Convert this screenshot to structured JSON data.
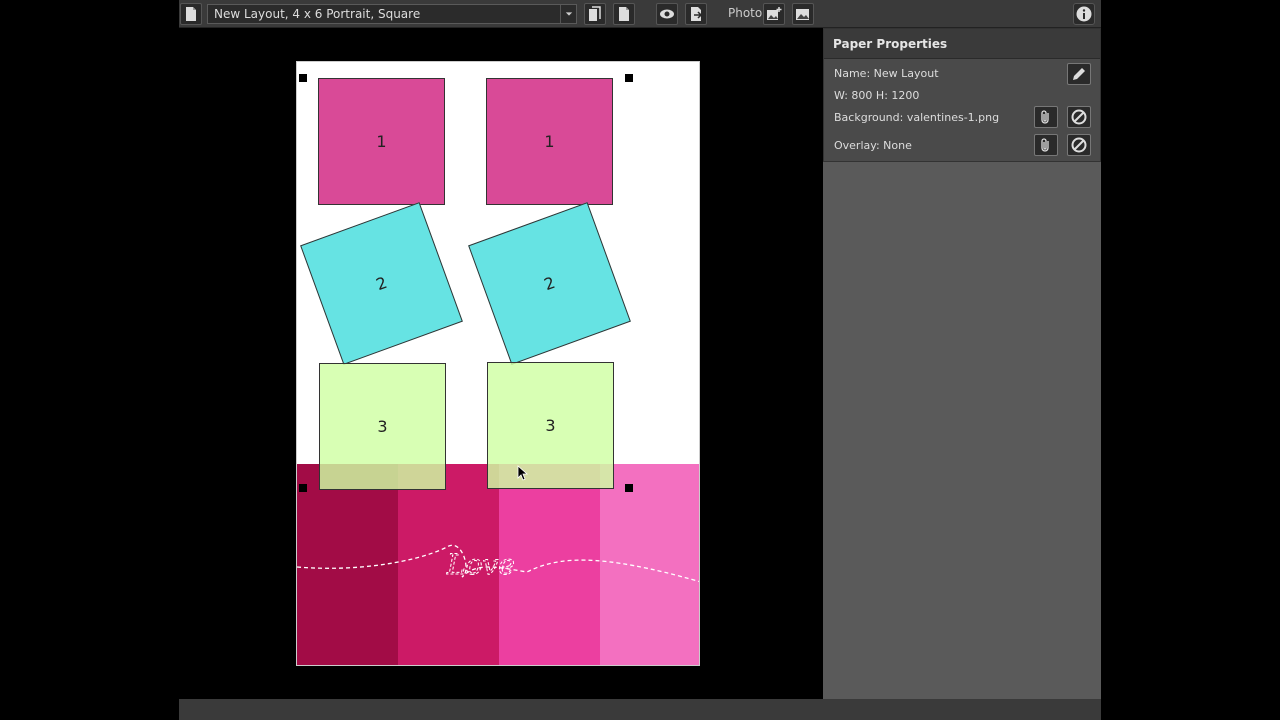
{
  "toolbar": {
    "layout_select_value": "New Layout, 4 x 6 Portrait, Square",
    "photo_label": "Photo"
  },
  "icons": {
    "new_page": "page-icon",
    "preview": "eye-icon",
    "export": "export-icon",
    "add_photo": "image-add-icon",
    "replace_photo": "image-icon",
    "info": "info-icon"
  },
  "paper": {
    "slots": [
      {
        "label": "1"
      },
      {
        "label": "1"
      },
      {
        "label": "2"
      },
      {
        "label": "2"
      },
      {
        "label": "3"
      },
      {
        "label": "3"
      }
    ],
    "background_colors": [
      "#a20c46",
      "#cc1a66",
      "#ec3fa0",
      "#f370c0"
    ],
    "decoration_text": "Love"
  },
  "properties": {
    "title": "Paper Properties",
    "name": "Name: New Layout",
    "size": "W: 800 H: 1200",
    "background": "Background: valentines-1.png",
    "overlay": "Overlay: None"
  }
}
